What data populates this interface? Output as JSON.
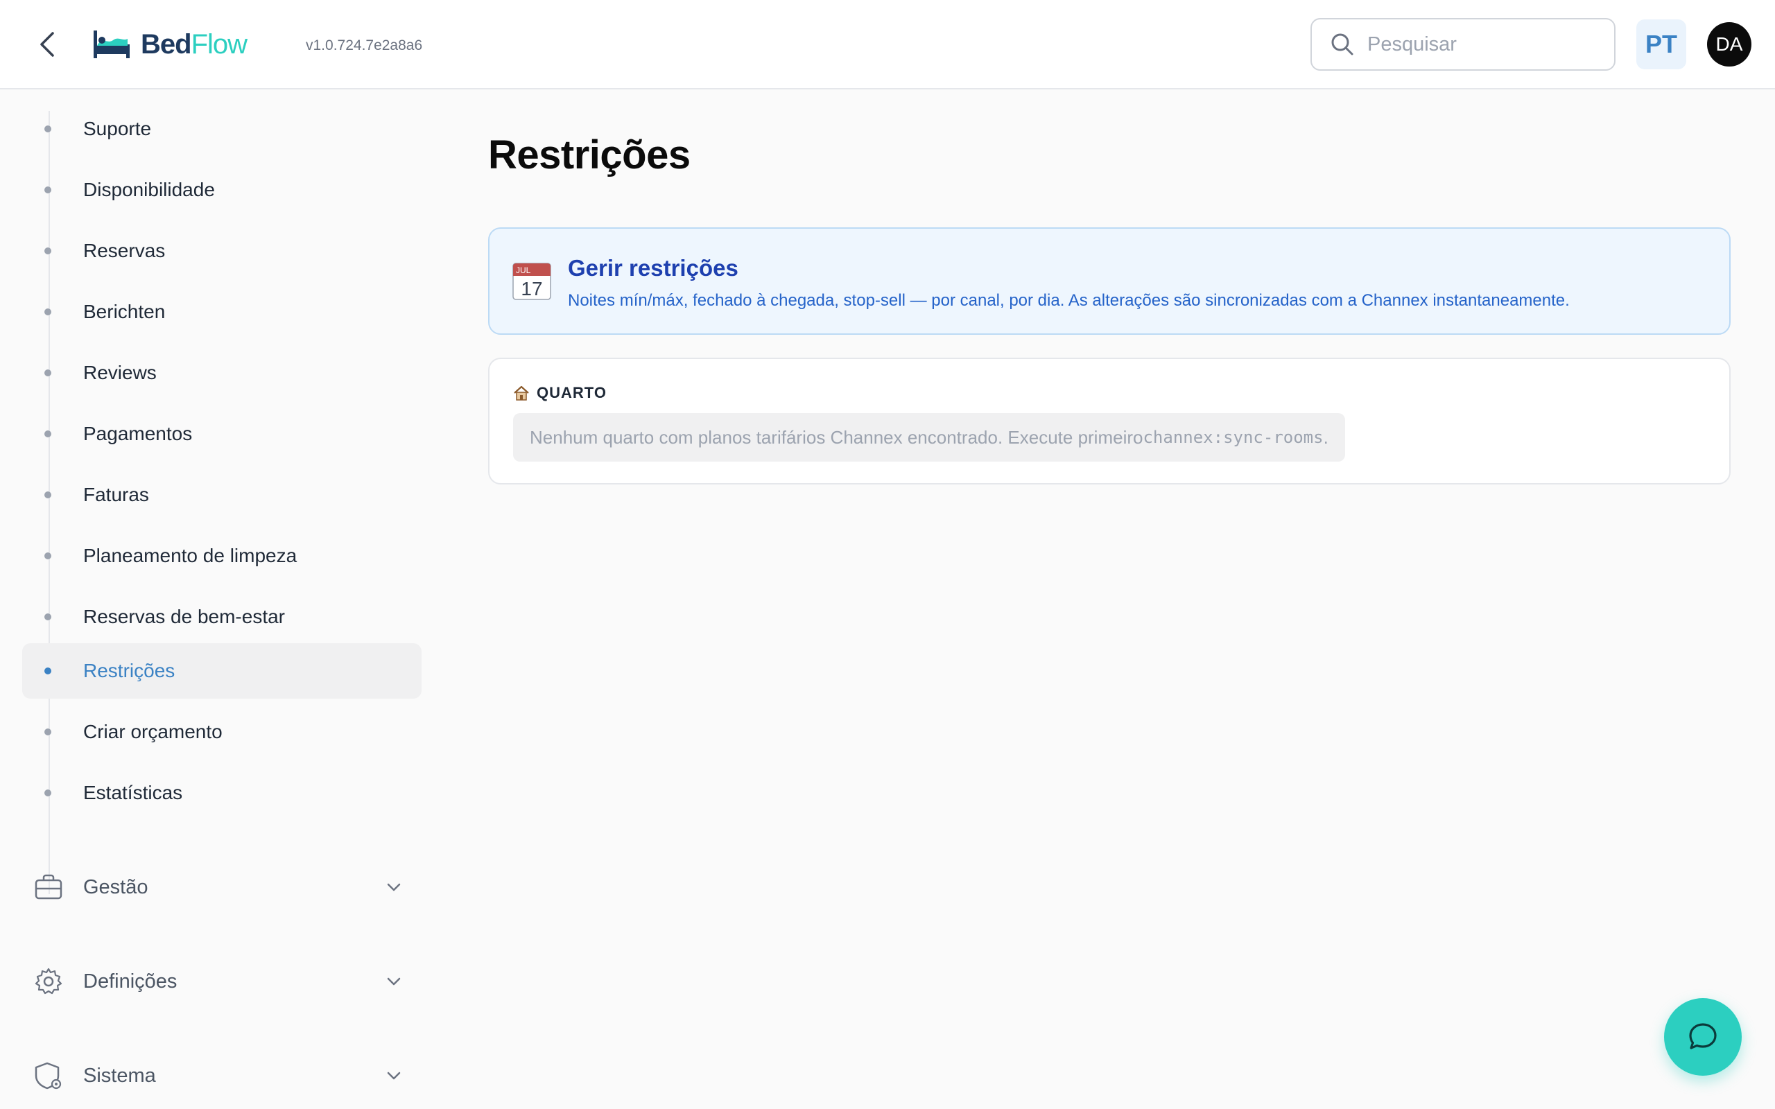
{
  "header": {
    "logo_part1": "Bed",
    "logo_part2": "Flow",
    "version": "v1.0.724.7e2a8a6",
    "search_placeholder": "Pesquisar",
    "language": "PT",
    "user_initials": "DA"
  },
  "sidebar": {
    "items": [
      {
        "label": "Suporte"
      },
      {
        "label": "Disponibilidade"
      },
      {
        "label": "Reservas"
      },
      {
        "label": "Berichten"
      },
      {
        "label": "Reviews"
      },
      {
        "label": "Pagamentos"
      },
      {
        "label": "Faturas"
      },
      {
        "label": "Planeamento de limpeza"
      },
      {
        "label": "Reservas de bem-estar"
      },
      {
        "label": "Restrições",
        "active": true
      },
      {
        "label": "Criar orçamento"
      },
      {
        "label": "Estatísticas"
      }
    ],
    "groups": [
      {
        "label": "Gestão",
        "icon": "briefcase-icon"
      },
      {
        "label": "Definições",
        "icon": "gear-icon"
      },
      {
        "label": "Sistema",
        "icon": "shield-gear-icon"
      }
    ]
  },
  "main": {
    "title": "Restrições",
    "info": {
      "icon_month": "JUL",
      "icon_day": "17",
      "title": "Gerir restrições",
      "description": "Noites mín/máx, fechado à chegada, stop-sell — por canal, por dia. As alterações são sincronizadas com a Channex instantaneamente."
    },
    "room": {
      "label": "QUARTO",
      "empty_text": "Nenhum quarto com planos tarifários Channex encontrado. Execute primeiro ",
      "empty_command": "channex:sync-rooms",
      "empty_suffix": "."
    }
  },
  "colors": {
    "accent": "#3b82c4",
    "brand_teal": "#2ccfc0",
    "brand_navy": "#1e3a5f",
    "info_bg": "#eef6fe"
  }
}
